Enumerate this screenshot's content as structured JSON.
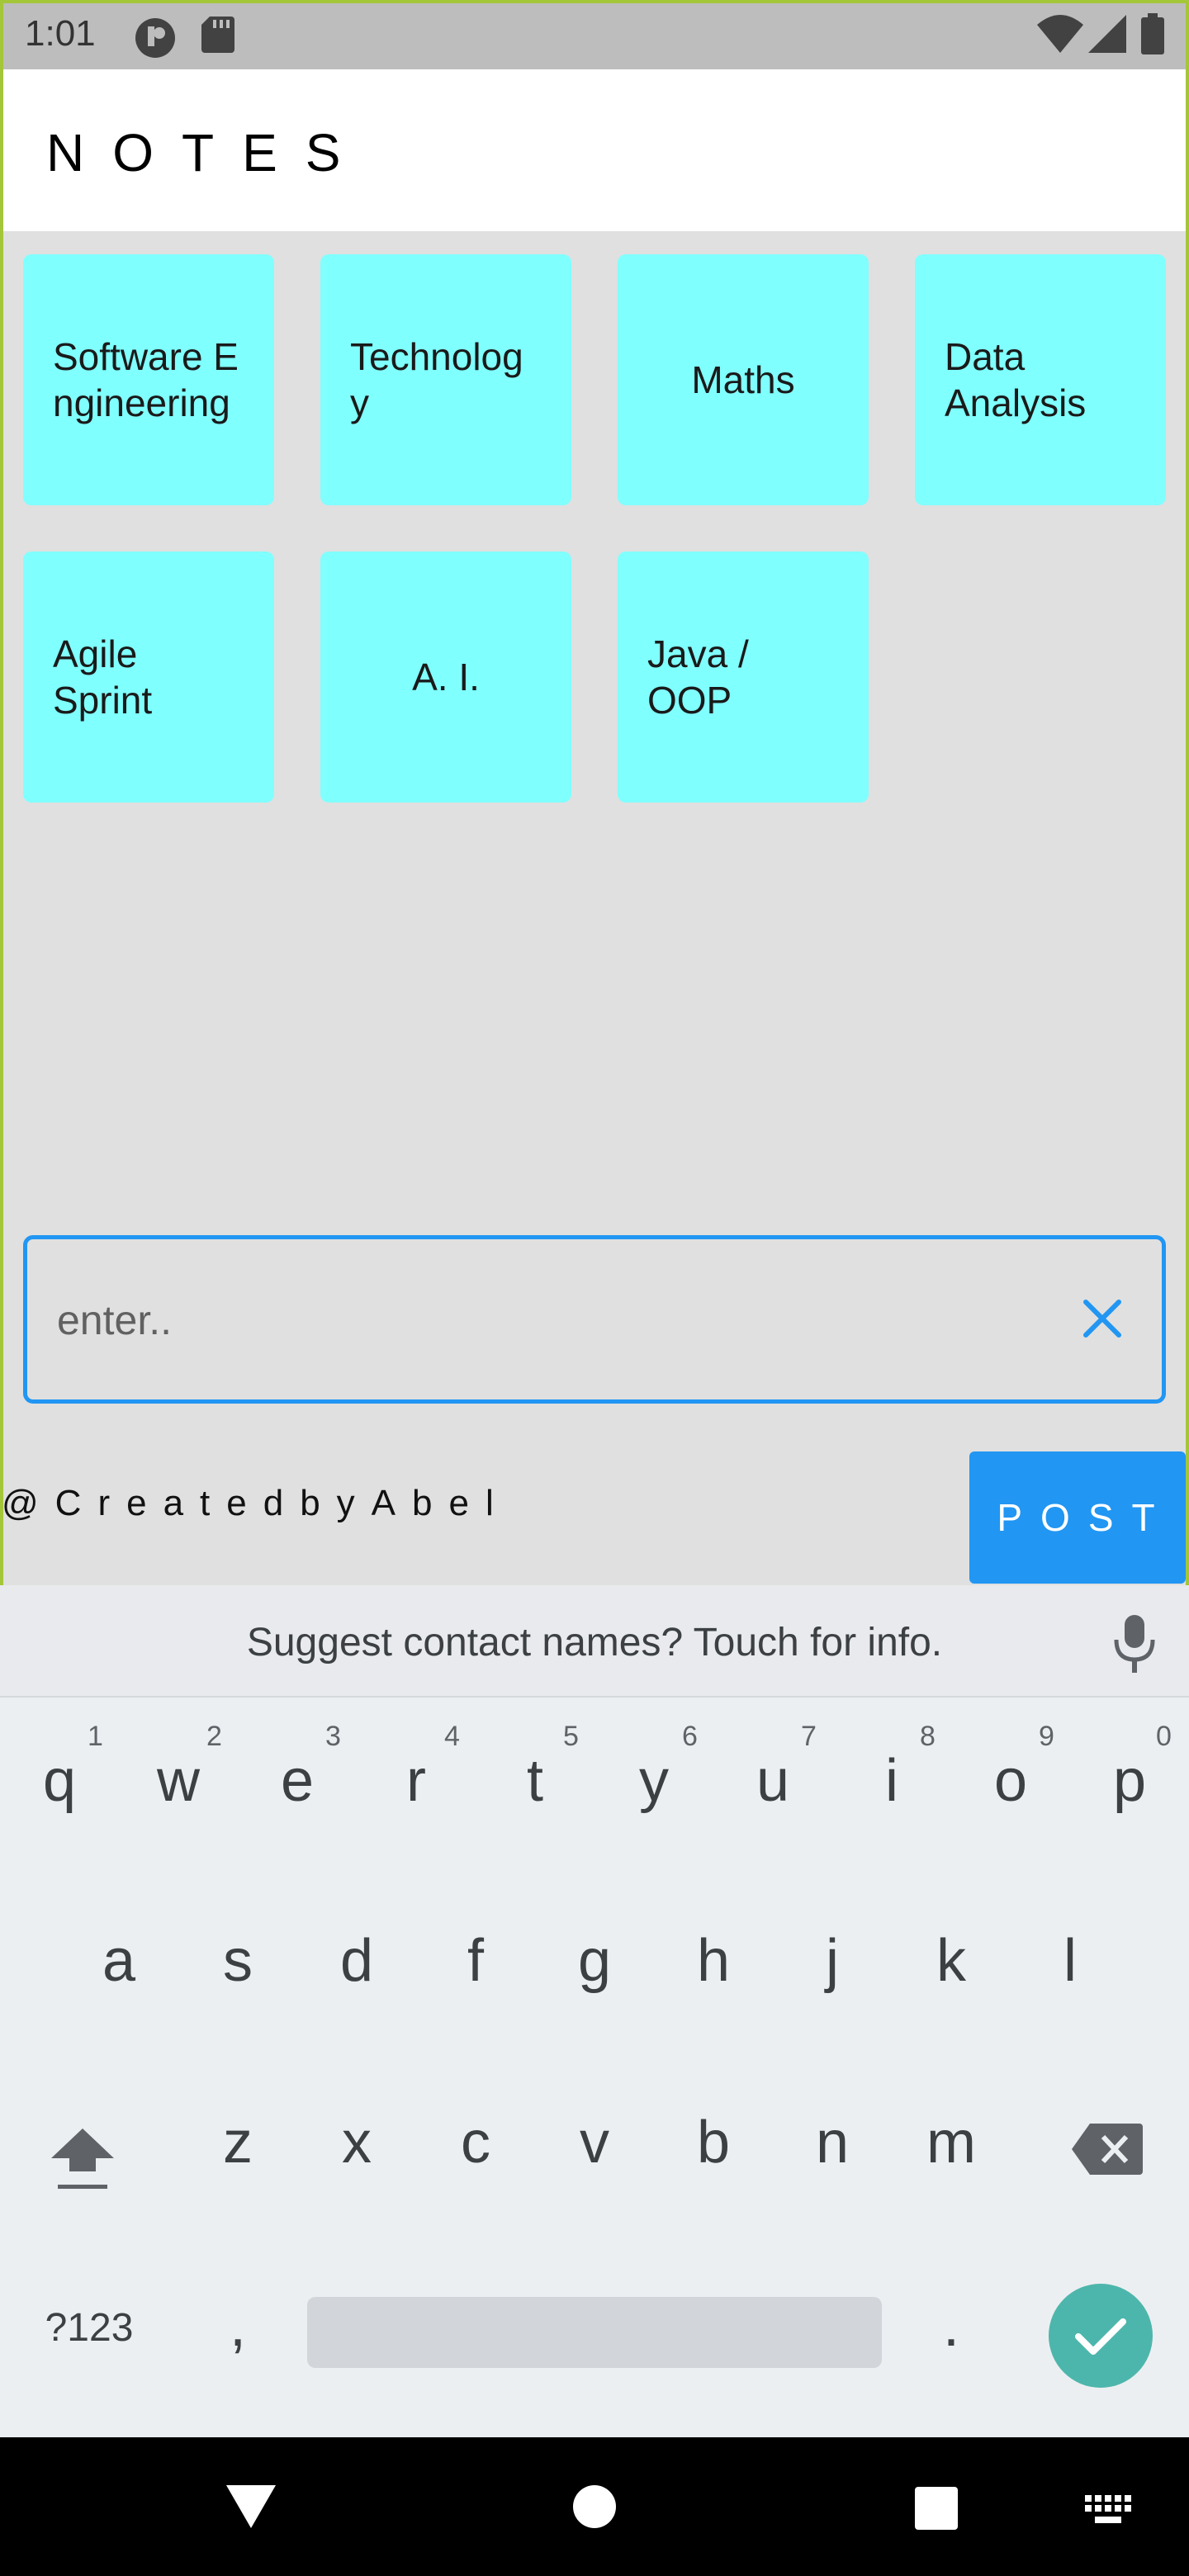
{
  "status_bar": {
    "time": "1:01",
    "icons": [
      "app-notification-icon",
      "sd-card-icon",
      "wifi-icon",
      "cellular-signal-icon",
      "battery-icon"
    ]
  },
  "app_bar": {
    "title": "NOTES"
  },
  "tiles": [
    {
      "label": "Software Engineering"
    },
    {
      "label": "Technology"
    },
    {
      "label": "Maths"
    },
    {
      "label": "Data Analysis"
    },
    {
      "label": "Agile Sprint"
    },
    {
      "label": "A. I."
    },
    {
      "label": "Java / OOP"
    }
  ],
  "input": {
    "placeholder": "enter..",
    "value": ""
  },
  "credit": "@CreatedbyAbel",
  "post_button": "POST",
  "keyboard": {
    "suggestion": "Suggest contact names? Touch for info.",
    "row1": [
      "q",
      "w",
      "e",
      "r",
      "t",
      "y",
      "u",
      "i",
      "o",
      "p"
    ],
    "row1_hints": [
      "1",
      "2",
      "3",
      "4",
      "5",
      "6",
      "7",
      "8",
      "9",
      "0"
    ],
    "row2": [
      "a",
      "s",
      "d",
      "f",
      "g",
      "h",
      "j",
      "k",
      "l"
    ],
    "row3": [
      "z",
      "x",
      "c",
      "v",
      "b",
      "n",
      "m"
    ],
    "symbols_key": "?123",
    "comma_key": ",",
    "period_key": "."
  },
  "colors": {
    "tile": "#80ffff",
    "accent": "#2196f3",
    "enter": "#4db6ac",
    "frame": "#a4c639"
  }
}
